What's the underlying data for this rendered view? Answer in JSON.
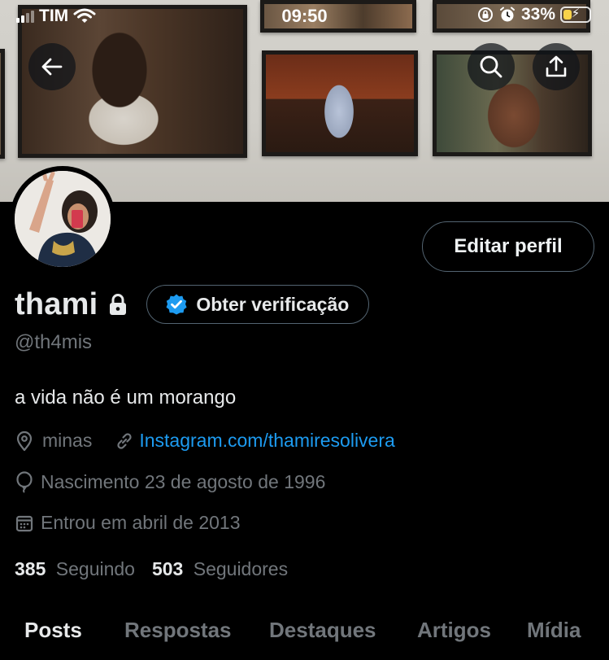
{
  "status_bar": {
    "carrier": "TIM",
    "time": "09:50",
    "battery_percent": "33%",
    "battery_level": 0.33,
    "icons": [
      "cellular-signal-icon",
      "wifi-icon",
      "orientation-lock-icon",
      "alarm-icon",
      "battery-charging-icon"
    ]
  },
  "banner": {
    "buttons": [
      "back-arrow-icon",
      "search-icon",
      "share-icon"
    ]
  },
  "profile": {
    "display_name": "thami",
    "handle": "@th4mis",
    "edit_button": "Editar perfil",
    "verify_button": "Obter verificação",
    "bio": "a vida não é um morango",
    "location": "minas",
    "website": "Instagram.com/thamiresolivera",
    "birth": "Nascimento 23 de agosto de 1996",
    "joined": "Entrou em abril de 2013",
    "following_count": "385",
    "following_label": "Seguindo",
    "followers_count": "503",
    "followers_label": "Seguidores"
  },
  "tabs": [
    "Posts",
    "Respostas",
    "Destaques",
    "Artigos",
    "Mídia"
  ],
  "active_tab": "Posts",
  "colors": {
    "background": "#000000",
    "text_primary": "#e7e9ea",
    "text_secondary": "#71767b",
    "link": "#1d9bf0",
    "border": "#536471",
    "battery_fill": "#f7d24a"
  }
}
